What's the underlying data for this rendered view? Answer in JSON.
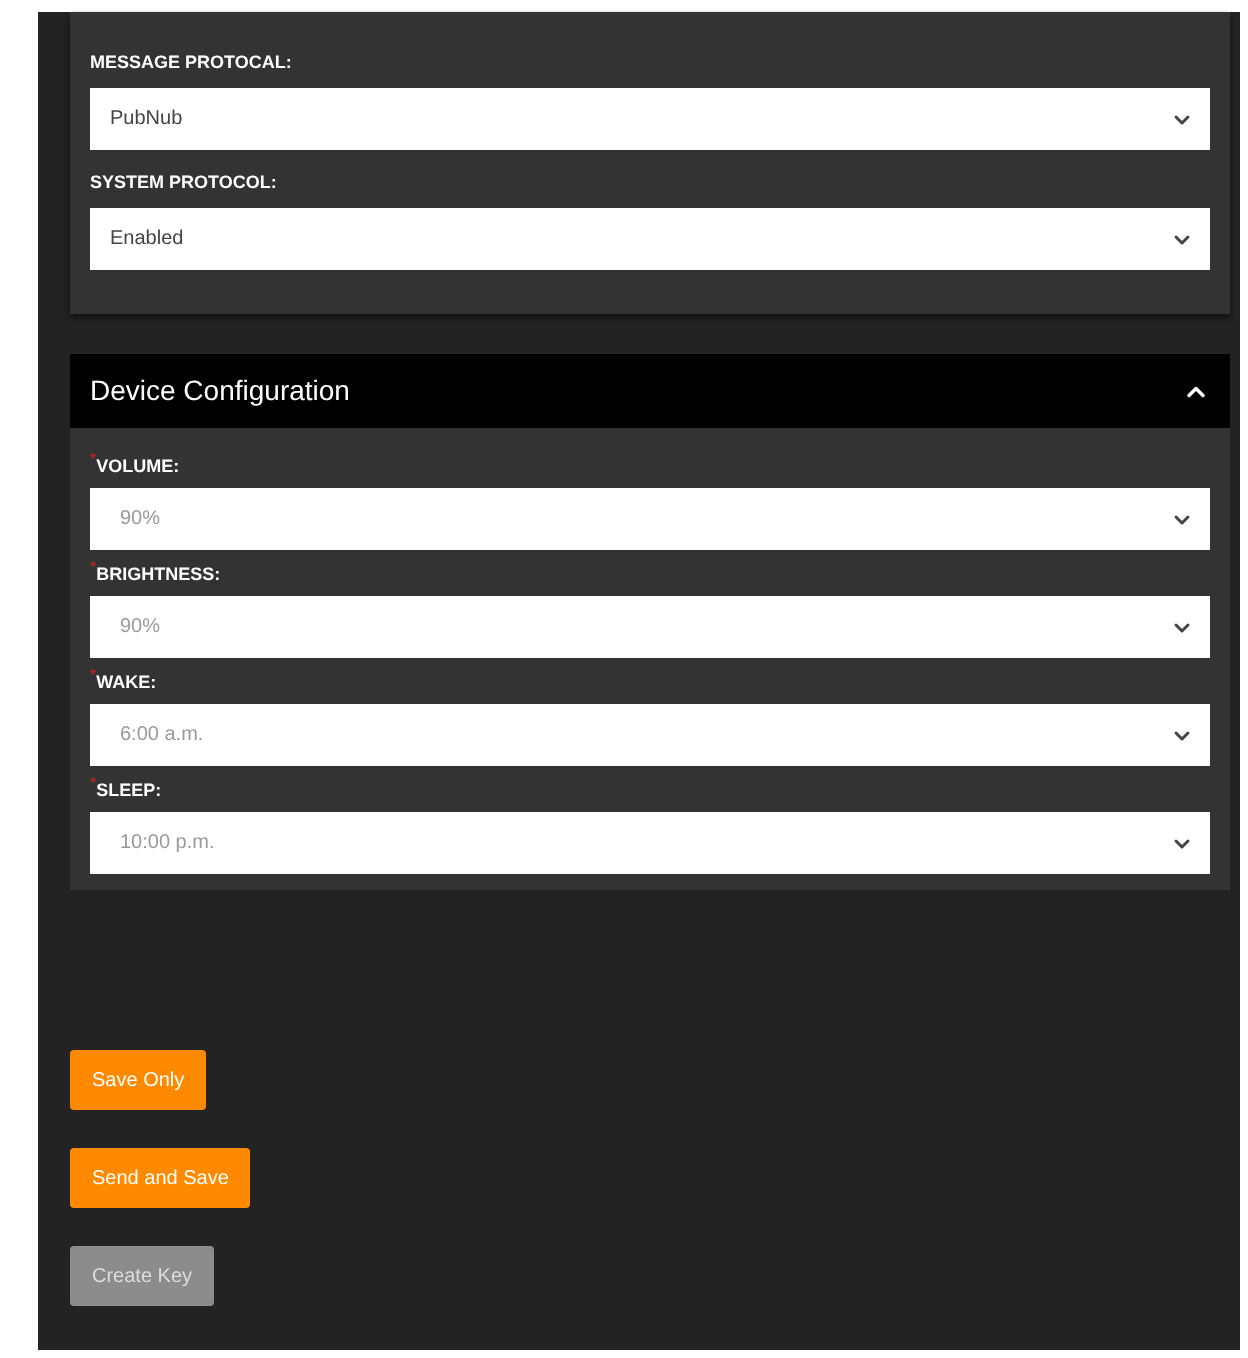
{
  "protocol_section": {
    "fields": [
      {
        "label": "MESSAGE PROTOCAL:",
        "value": "PubNub"
      },
      {
        "label": "SYSTEM PROTOCOL:",
        "value": "Enabled"
      }
    ]
  },
  "device_configuration": {
    "title": "Device Configuration",
    "expanded": true,
    "fields": [
      {
        "required_mark": "*",
        "label": "VOLUME:",
        "value": "90%"
      },
      {
        "required_mark": "*",
        "label": "BRIGHTNESS:",
        "value": "90%"
      },
      {
        "required_mark": "*",
        "label": "WAKE:",
        "value": "6:00 a.m."
      },
      {
        "required_mark": "*",
        "label": "SLEEP:",
        "value": "10:00 p.m."
      }
    ]
  },
  "buttons": [
    {
      "label": "Save Only",
      "disabled": false
    },
    {
      "label": "Send and Save",
      "disabled": false
    },
    {
      "label": "Create Key",
      "disabled": true
    }
  ]
}
